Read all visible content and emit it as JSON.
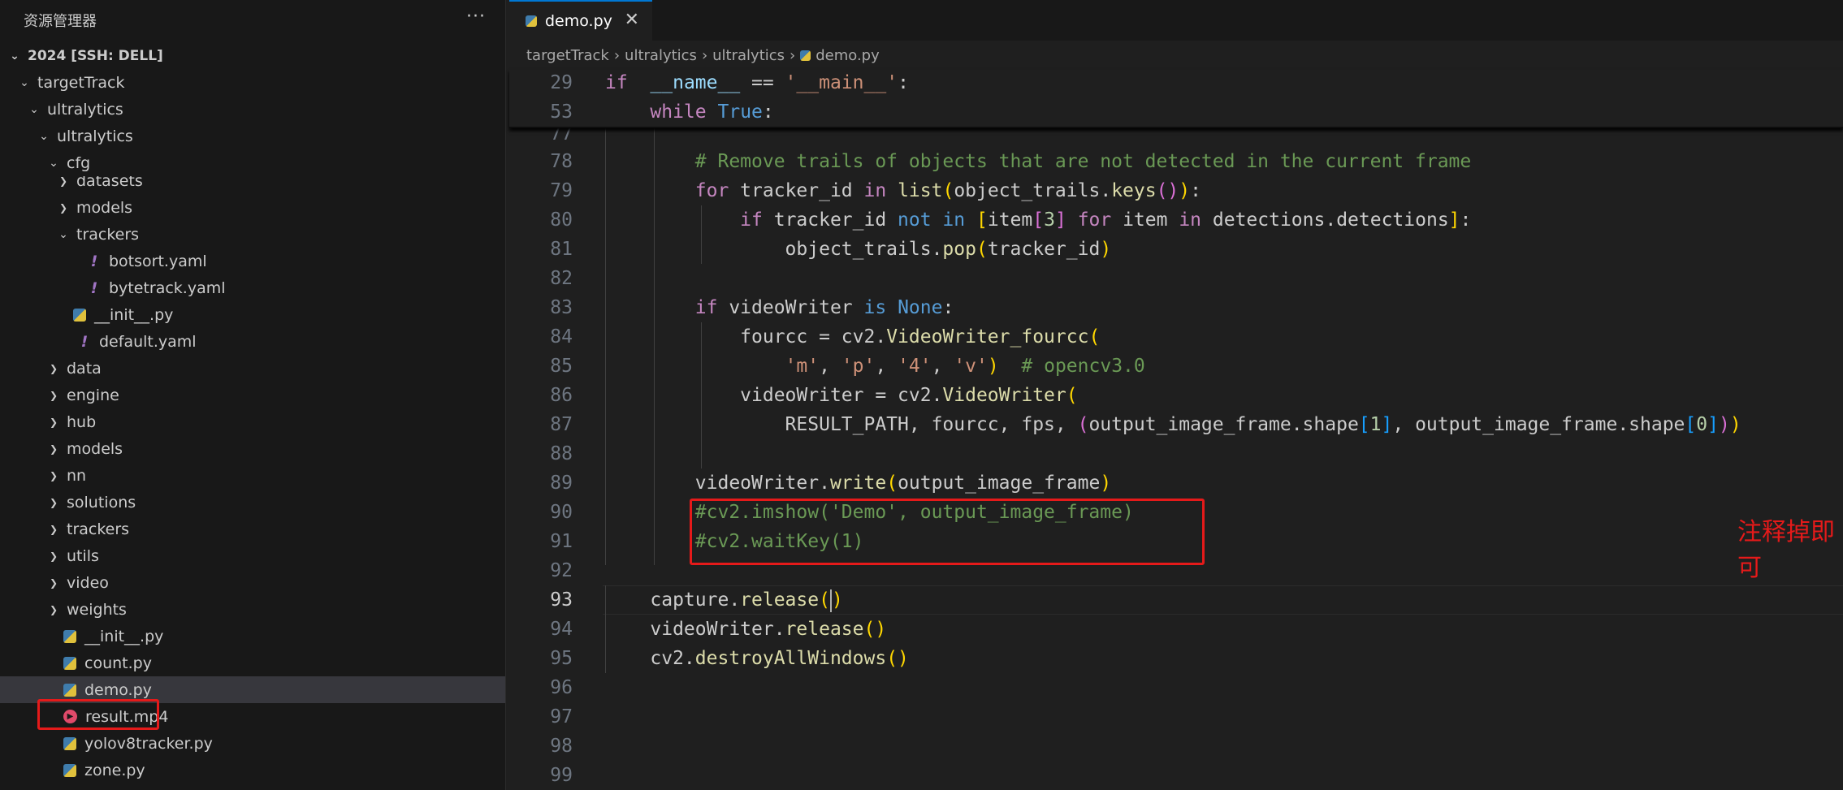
{
  "explorer": {
    "title": "资源管理器",
    "more": "···",
    "tree": [
      {
        "label": "2024 [SSH: DELL]",
        "depth": 0,
        "type": "folder-open",
        "bold": true
      },
      {
        "label": "targetTrack",
        "depth": 1,
        "type": "folder-open"
      },
      {
        "label": "ultralytics",
        "depth": 2,
        "type": "folder-open"
      },
      {
        "label": "ultralytics",
        "depth": 3,
        "type": "folder-open"
      },
      {
        "label": "cfg",
        "depth": 4,
        "type": "folder-open"
      },
      {
        "label": "datasets",
        "depth": 5,
        "type": "folder"
      },
      {
        "label": "models",
        "depth": 5,
        "type": "folder"
      },
      {
        "label": "trackers",
        "depth": 5,
        "type": "folder-open"
      },
      {
        "label": "botsort.yaml",
        "depth": 6,
        "type": "yaml"
      },
      {
        "label": "bytetrack.yaml",
        "depth": 6,
        "type": "yaml"
      },
      {
        "label": "__init__.py",
        "depth": 5,
        "type": "py"
      },
      {
        "label": "default.yaml",
        "depth": 5,
        "type": "yaml"
      },
      {
        "label": "data",
        "depth": 4,
        "type": "folder"
      },
      {
        "label": "engine",
        "depth": 4,
        "type": "folder"
      },
      {
        "label": "hub",
        "depth": 4,
        "type": "folder"
      },
      {
        "label": "models",
        "depth": 4,
        "type": "folder"
      },
      {
        "label": "nn",
        "depth": 4,
        "type": "folder"
      },
      {
        "label": "solutions",
        "depth": 4,
        "type": "folder"
      },
      {
        "label": "trackers",
        "depth": 4,
        "type": "folder"
      },
      {
        "label": "utils",
        "depth": 4,
        "type": "folder"
      },
      {
        "label": "video",
        "depth": 4,
        "type": "folder"
      },
      {
        "label": "weights",
        "depth": 4,
        "type": "folder"
      },
      {
        "label": "__init__.py",
        "depth": 4,
        "type": "py"
      },
      {
        "label": "count.py",
        "depth": 4,
        "type": "py"
      },
      {
        "label": "demo.py",
        "depth": 4,
        "type": "py",
        "selected": true
      },
      {
        "label": "result.mp4",
        "depth": 4,
        "type": "mp4"
      },
      {
        "label": "yolov8tracker.py",
        "depth": 4,
        "type": "py"
      },
      {
        "label": "zone.py",
        "depth": 4,
        "type": "py"
      }
    ]
  },
  "tab": {
    "label": "demo.py",
    "close": "✕"
  },
  "breadcrumb": [
    "targetTrack",
    "ultralytics",
    "ultralytics",
    "demo.py"
  ],
  "code": {
    "sticky": [
      {
        "ln": "29",
        "tokens": [
          [
            "k",
            "if"
          ],
          [
            "",
            "  "
          ],
          [
            "v",
            "__name__"
          ],
          [
            "",
            " == "
          ],
          [
            "s",
            "'__main__'"
          ],
          [
            "",
            ":"
          ]
        ]
      },
      {
        "ln": "53",
        "tokens": [
          [
            "",
            "    "
          ],
          [
            "k",
            "while"
          ],
          [
            "",
            " "
          ],
          [
            "b",
            "True"
          ],
          [
            "",
            ":"
          ]
        ]
      }
    ],
    "lines": [
      {
        "ln": "77",
        "tokens": []
      },
      {
        "ln": "78",
        "tokens": [
          [
            "",
            "        "
          ],
          [
            "c",
            "# Remove trails of objects that are not detected in the current frame"
          ]
        ]
      },
      {
        "ln": "79",
        "tokens": [
          [
            "",
            "        "
          ],
          [
            "k",
            "for"
          ],
          [
            "",
            " tracker_id "
          ],
          [
            "k",
            "in"
          ],
          [
            "",
            " "
          ],
          [
            "f",
            "list"
          ],
          [
            "p1",
            "("
          ],
          [
            "",
            "object_trails."
          ],
          [
            "f",
            "keys"
          ],
          [
            "p2",
            "()"
          ],
          [
            "p1",
            ")"
          ],
          [
            "",
            ":"
          ]
        ]
      },
      {
        "ln": "80",
        "tokens": [
          [
            "",
            "            "
          ],
          [
            "k",
            "if"
          ],
          [
            "",
            " tracker_id "
          ],
          [
            "b",
            "not in"
          ],
          [
            "",
            " "
          ],
          [
            "p1",
            "["
          ],
          [
            "",
            "item"
          ],
          [
            "p2",
            "["
          ],
          [
            "n",
            "3"
          ],
          [
            "p2",
            "]"
          ],
          [
            "",
            " "
          ],
          [
            "k",
            "for"
          ],
          [
            "",
            " item "
          ],
          [
            "k",
            "in"
          ],
          [
            "",
            " detections.detections"
          ],
          [
            "p1",
            "]"
          ],
          [
            "",
            ":"
          ]
        ]
      },
      {
        "ln": "81",
        "tokens": [
          [
            "",
            "                object_trails."
          ],
          [
            "f",
            "pop"
          ],
          [
            "p1",
            "("
          ],
          [
            "",
            "tracker_id"
          ],
          [
            "p1",
            ")"
          ]
        ]
      },
      {
        "ln": "82",
        "tokens": []
      },
      {
        "ln": "83",
        "tokens": [
          [
            "",
            "        "
          ],
          [
            "k",
            "if"
          ],
          [
            "",
            " videoWriter "
          ],
          [
            "b",
            "is"
          ],
          [
            "",
            " "
          ],
          [
            "b",
            "None"
          ],
          [
            "",
            ":"
          ]
        ]
      },
      {
        "ln": "84",
        "tokens": [
          [
            "",
            "            fourcc = cv2."
          ],
          [
            "f",
            "VideoWriter_fourcc"
          ],
          [
            "p1",
            "("
          ]
        ]
      },
      {
        "ln": "85",
        "tokens": [
          [
            "",
            "                "
          ],
          [
            "s",
            "'m'"
          ],
          [
            "",
            ", "
          ],
          [
            "s",
            "'p'"
          ],
          [
            "",
            ", "
          ],
          [
            "s",
            "'4'"
          ],
          [
            "",
            ", "
          ],
          [
            "s",
            "'v'"
          ],
          [
            "p1",
            ")"
          ],
          [
            "",
            "  "
          ],
          [
            "c",
            "# opencv3.0"
          ]
        ]
      },
      {
        "ln": "86",
        "tokens": [
          [
            "",
            "            videoWriter = cv2."
          ],
          [
            "f",
            "VideoWriter"
          ],
          [
            "p1",
            "("
          ]
        ]
      },
      {
        "ln": "87",
        "tokens": [
          [
            "",
            "                RESULT_PATH, fourcc, fps, "
          ],
          [
            "p2",
            "("
          ],
          [
            "",
            "output_image_frame.shape"
          ],
          [
            "p3",
            "["
          ],
          [
            "n",
            "1"
          ],
          [
            "p3",
            "]"
          ],
          [
            "",
            ", output_image_frame.shape"
          ],
          [
            "p3",
            "["
          ],
          [
            "n",
            "0"
          ],
          [
            "p3",
            "]"
          ],
          [
            "p2",
            ")"
          ],
          [
            "p1",
            ")"
          ]
        ]
      },
      {
        "ln": "88",
        "tokens": []
      },
      {
        "ln": "89",
        "tokens": [
          [
            "",
            "        videoWriter."
          ],
          [
            "f",
            "write"
          ],
          [
            "p1",
            "("
          ],
          [
            "",
            "output_image_frame"
          ],
          [
            "p1",
            ")"
          ]
        ]
      },
      {
        "ln": "90",
        "tokens": [
          [
            "",
            "        "
          ],
          [
            "c",
            "#cv2.imshow('Demo', output_image_frame)"
          ]
        ]
      },
      {
        "ln": "91",
        "tokens": [
          [
            "",
            "        "
          ],
          [
            "c",
            "#cv2.waitKey(1)"
          ]
        ]
      },
      {
        "ln": "92",
        "tokens": []
      },
      {
        "ln": "93",
        "active": true,
        "tokens": [
          [
            "",
            "    capture."
          ],
          [
            "f",
            "release"
          ],
          [
            "p1",
            "("
          ],
          [
            "caret",
            ""
          ],
          [
            "p1",
            ")"
          ]
        ]
      },
      {
        "ln": "94",
        "tokens": [
          [
            "",
            "    videoWriter."
          ],
          [
            "f",
            "release"
          ],
          [
            "p1",
            "()"
          ]
        ]
      },
      {
        "ln": "95",
        "tokens": [
          [
            "",
            "    cv2."
          ],
          [
            "f",
            "destroyAllWindows"
          ],
          [
            "p1",
            "()"
          ]
        ]
      },
      {
        "ln": "96",
        "tokens": []
      },
      {
        "ln": "97",
        "tokens": []
      },
      {
        "ln": "98",
        "tokens": []
      },
      {
        "ln": "99",
        "tokens": []
      }
    ]
  },
  "annotation": "注释掉即可"
}
